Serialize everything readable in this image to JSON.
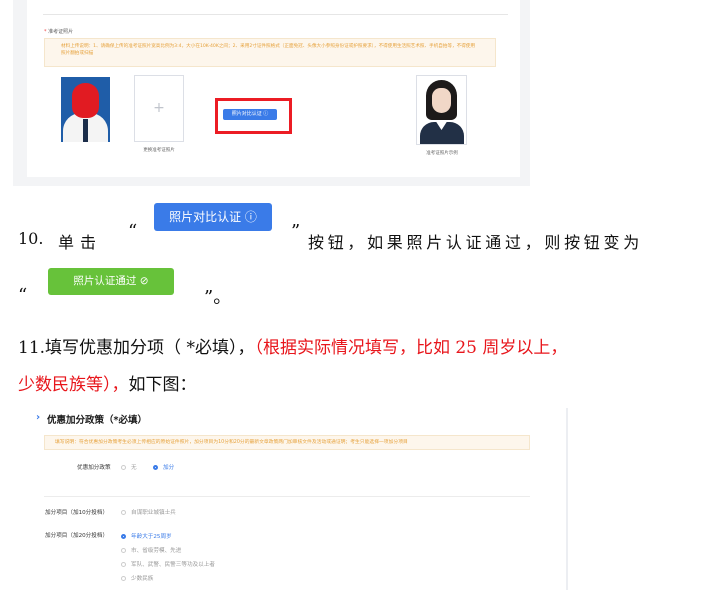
{
  "shot1": {
    "label_star": "*",
    "label_text": "准考证照片",
    "notice": "材料上传说明：1、请确保上传的准考证照片宽高比例为3:4，大小在10K-40K之间；2、采用2寸证件照格式（正面免冠、头像大小参照身份证或护照要求），不得使用生活照艺术照、手机自拍等，不得使用照片翻拍或扫描",
    "upload_caption": "更换准考证照片",
    "compare_button": "照片对比认证 ⓘ",
    "sample_caption": "准考证照片示例"
  },
  "step10": {
    "num": "10.",
    "word_click": "单击",
    "quote_open": "“",
    "quote_close": "”",
    "rest": "按钮，如果照片认证通过，则按钮变为",
    "btn_blue": "照片对比认证 ⓘ",
    "btn_green": "照片认证通过 ⊘",
    "end_quote_open": "“",
    "end_quote_close": "”。"
  },
  "step11": {
    "line1_black": "11.填写优惠加分项（ *必填），",
    "line1_red": "（根据实际情况填写，比如 25 周岁以上，",
    "line2_red": "少数民族等），",
    "line2_black": "如下图："
  },
  "shot2": {
    "chevron": "›",
    "title": "优惠加分政策（*必填）",
    "notice": "填写说明：符合优惠加分政策考生必须上传相应的原始证件照片，加分项目为10分和20分的最新文章政策两门加审核文件及活动或通证明；考生只能选择一项加分项目",
    "policy_label": "优惠加分政策",
    "policy_options": [
      {
        "text": "无",
        "on": false
      },
      {
        "text": "加分",
        "on": true
      }
    ],
    "bonus10_label": "加分项目（加10分投档）",
    "bonus10_options": [
      {
        "text": "自谋职业城镇士兵",
        "on": false
      }
    ],
    "bonus20_label": "加分项目（加20分投档）",
    "bonus20_options": [
      {
        "text": "年龄大于25周岁",
        "on": true
      },
      {
        "text": "市、省级劳模、先进",
        "on": false
      },
      {
        "text": "军队、武警、民警三等功及以上者",
        "on": false
      },
      {
        "text": "少数民族",
        "on": false
      }
    ]
  },
  "colors": {
    "accent_blue": "#3a7be8",
    "success_green": "#67c23a",
    "highlight_red": "#ec1c24",
    "note_red_text": "#e8151b",
    "notice_orange": "#e6a23c"
  }
}
